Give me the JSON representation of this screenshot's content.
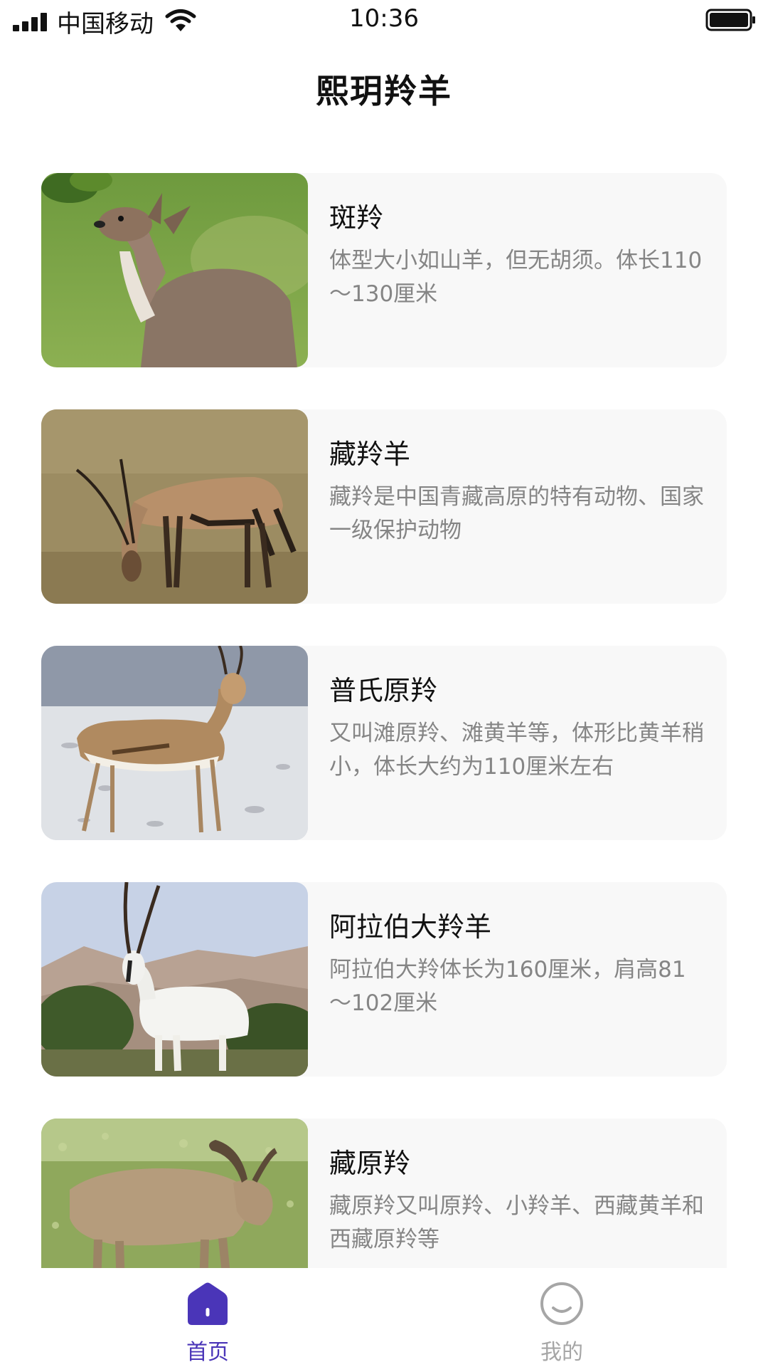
{
  "status_bar": {
    "carrier": "中国移动",
    "time": "10:36"
  },
  "header": {
    "title": "熙玥羚羊"
  },
  "animals": [
    {
      "name": "斑羚",
      "description": "体型大小如山羊，但无胡须。体长110～130厘米",
      "photo": "goral-eating-leaves"
    },
    {
      "name": "藏羚羊",
      "description": "藏羚是中国青藏高原的特有动物、国家一级保护动物",
      "photo": "tibetan-antelope-grazing"
    },
    {
      "name": "普氏原羚",
      "description": "又叫滩原羚、滩黄羊等，体形比黄羊稍小，体长大约为110厘米左右",
      "photo": "gazelle-on-stones"
    },
    {
      "name": "阿拉伯大羚羊",
      "description": "阿拉伯大羚体长为160厘米，肩高81～102厘米",
      "photo": "arabian-oryx"
    },
    {
      "name": "藏原羚",
      "description": "藏原羚又叫原羚、小羚羊、西藏黄羊和西藏原羚等",
      "photo": "ibex-on-grass"
    }
  ],
  "tab_bar": {
    "home_label": "首页",
    "mine_label": "我的",
    "active": "home",
    "active_color": "#4a35b8",
    "inactive_color": "#a6a6a6"
  }
}
